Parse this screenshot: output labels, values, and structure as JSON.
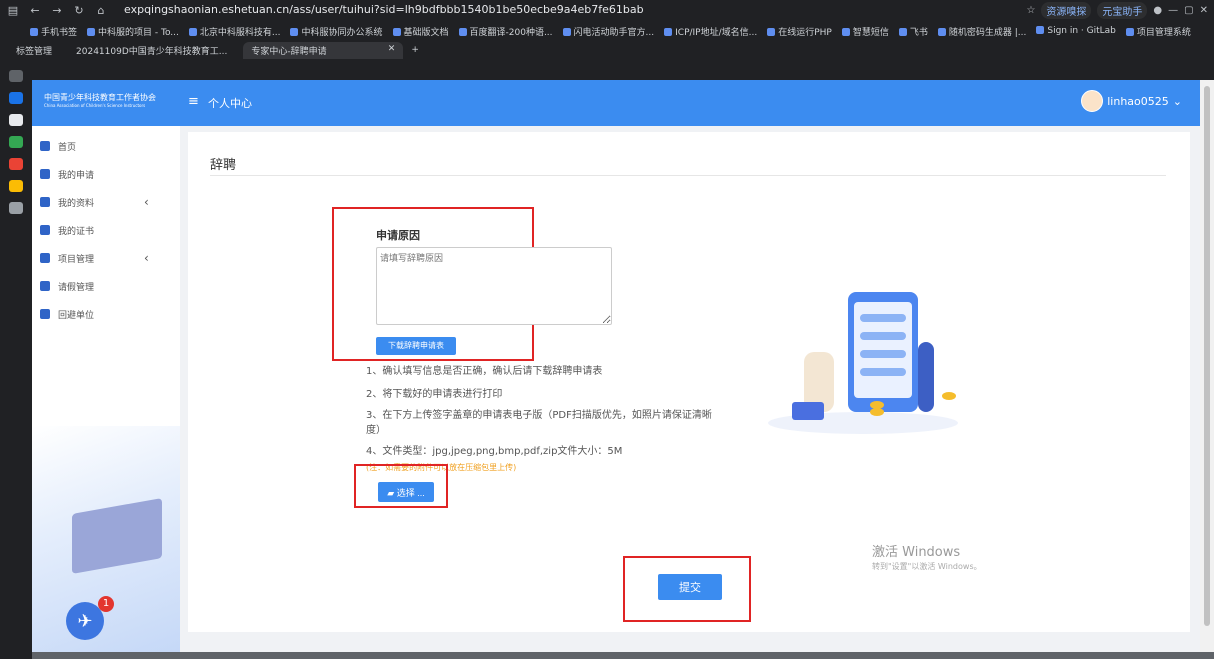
{
  "browser": {
    "url": "expqingshaonian.eshetuan.cn/ass/user/tuihui?sid=lh9bdfbbb1540b1be50ecbe9a4eb7fe61bab",
    "chips": [
      "资源嗅探",
      "元宝助手"
    ],
    "bookmarks": [
      "手机书签",
      "中科服的项目 - To...",
      "北京中科服科技有...",
      "中科服协同办公系统",
      "基础版文档",
      "百度翻译-200种语...",
      "闪电活动助手官方...",
      "ICP/IP地址/域名信...",
      "在线运行PHP",
      "智慧短信",
      "飞书",
      "随机密码生成器 |...",
      "Sign in · GitLab",
      "项目管理系统"
    ],
    "tabs": [
      "标签管理",
      "20241109D中国青少年科技教育工...",
      "专家中心-辞聘申请"
    ]
  },
  "header": {
    "org": "中国青少年科技教育工作者协会",
    "org_en": "China Association of Children's Science Instructors",
    "menu_label": "个人中心",
    "username": "linhao0525"
  },
  "nav": [
    {
      "label": "首页"
    },
    {
      "label": "我的申请"
    },
    {
      "label": "我的资料",
      "arrow": "‹"
    },
    {
      "label": "我的证书"
    },
    {
      "label": "项目管理",
      "arrow": "‹"
    },
    {
      "label": "请假管理"
    },
    {
      "label": "回避单位"
    }
  ],
  "badge_count": "1",
  "main": {
    "title": "辞聘",
    "reason_label": "申请原因",
    "reason_placeholder": "请填写辞聘原因",
    "download_label": "下载辞聘申请表",
    "steps": [
      "1、确认填写信息是否正确，确认后请下载辞聘申请表",
      "2、将下载好的申请表进行打印",
      "3、在下方上传签字盖章的申请表电子版（PDF扫描版优先，如照片请保证清晰度）",
      "4、文件类型：jpg,jpeg,png,bmp,pdf,zip文件大小：5M"
    ],
    "note": "(注：如需要的附件可以放在压缩包里上传)",
    "choose_label": "选择 ...",
    "submit_label": "提交"
  },
  "watermark": {
    "title": "激活 Windows",
    "sub": "转到\"设置\"以激活 Windows。"
  },
  "colors": {
    "primary": "#3b8cf0",
    "highlight": "#e02424"
  }
}
